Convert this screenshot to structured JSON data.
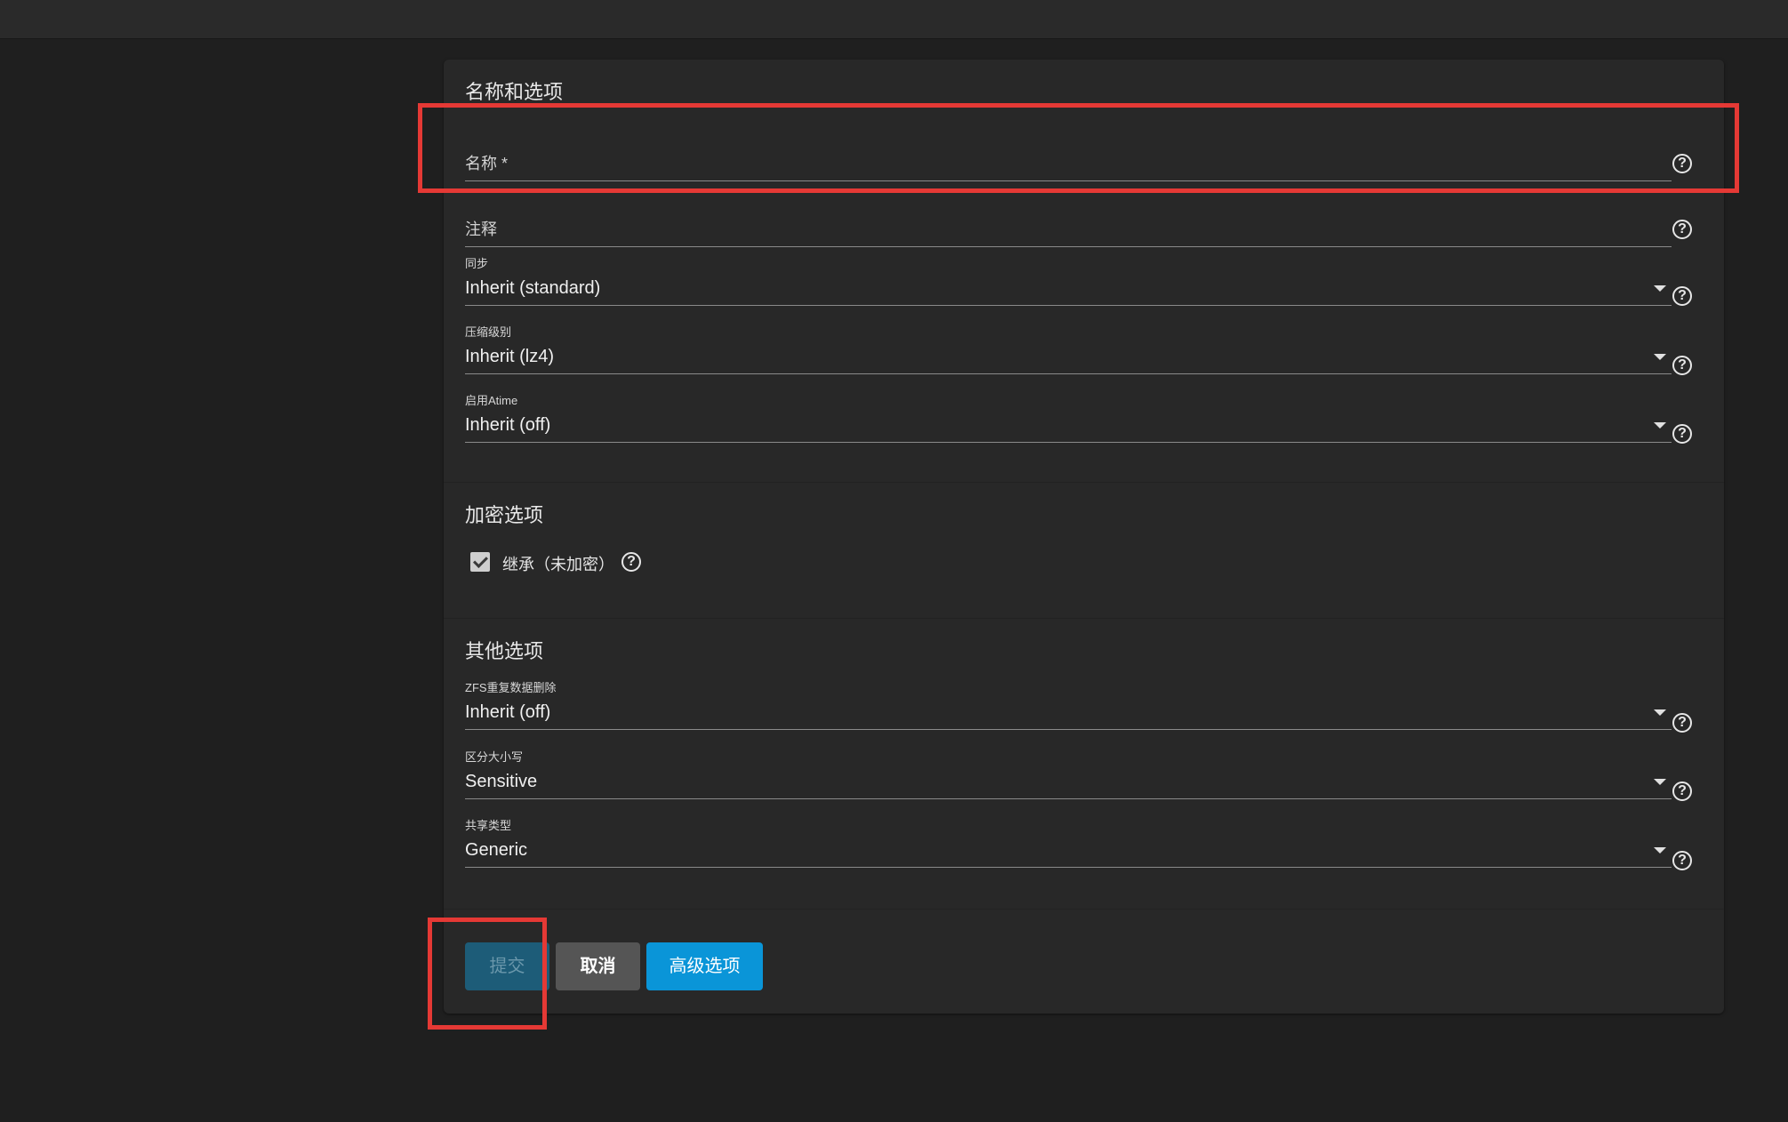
{
  "sections": {
    "name_options": {
      "title": "名称和选项",
      "fields": {
        "name": {
          "label": "名称 *"
        },
        "comment": {
          "label": "注释"
        },
        "sync": {
          "label": "同步",
          "value": "Inherit (standard)"
        },
        "compression": {
          "label": "压缩级别",
          "value": "Inherit (lz4)"
        },
        "atime": {
          "label": "启用Atime",
          "value": "Inherit (off)"
        }
      }
    },
    "encryption": {
      "title": "加密选项",
      "inherit_checkbox": {
        "label": "继承（未加密）",
        "checked": true
      }
    },
    "other": {
      "title": "其他选项",
      "fields": {
        "dedup": {
          "label": "ZFS重复数据删除",
          "value": "Inherit (off)"
        },
        "case_sensitivity": {
          "label": "区分大小写",
          "value": "Sensitive"
        },
        "share_type": {
          "label": "共享类型",
          "value": "Generic"
        }
      }
    }
  },
  "buttons": {
    "submit": "提交",
    "cancel": "取消",
    "advanced": "高级选项"
  },
  "icons": {
    "help": "?"
  },
  "colors": {
    "primary": "#0a95d8",
    "submit_disabled": "#1d5c78",
    "cancel": "#555555",
    "highlight": "#e53935",
    "background": "#1f1f1f",
    "card": "#282828"
  }
}
